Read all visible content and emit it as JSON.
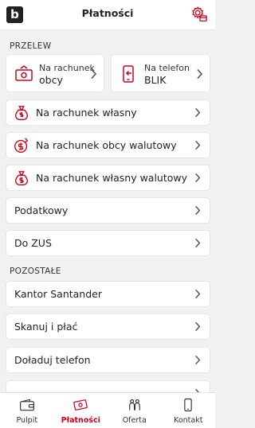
{
  "header": {
    "logo_letter": "b",
    "title": "Płatności"
  },
  "sections": {
    "transfer": "PRZELEW",
    "other": "POZOSTAŁE"
  },
  "tiles": [
    {
      "line1": "Na rachunek",
      "line2": "obcy"
    },
    {
      "line1": "Na telefon",
      "line2": "BLIK"
    }
  ],
  "transfer_rows": [
    {
      "label": "Na rachunek własny"
    },
    {
      "label": "Na rachunek obcy walutowy"
    },
    {
      "label": "Na rachunek własny walutowy"
    },
    {
      "label": "Podatkowy"
    },
    {
      "label": "Do ZUS"
    }
  ],
  "other_rows": [
    {
      "label": "Kantor Santander"
    },
    {
      "label": "Skanuj i płać"
    },
    {
      "label": "Doładuj telefon"
    }
  ],
  "tabs": [
    {
      "label": "Pulpit"
    },
    {
      "label": "Płatności"
    },
    {
      "label": "Oferta"
    },
    {
      "label": "Kontakt"
    }
  ],
  "colors": {
    "accent": "#d0021b",
    "background": "#f1f1f1",
    "card": "#ffffff"
  }
}
